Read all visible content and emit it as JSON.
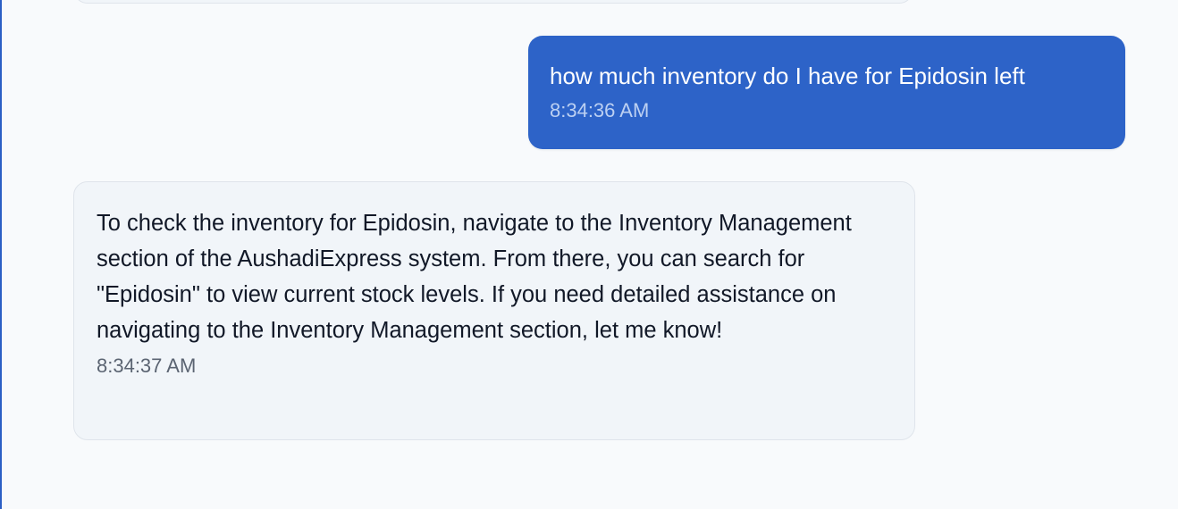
{
  "messages": [
    {
      "role": "user",
      "text": "how much inventory do I have for Epidosin left",
      "time": "8:34:36 AM"
    },
    {
      "role": "assistant",
      "text": "To check the inventory for Epidosin, navigate to the Inventory Management section of the AushadiExpress system. From there, you can search for \"Epidosin\" to view current stock levels. If you need detailed assistance on navigating to the Inventory Management section, let me know!",
      "time": "8:34:37 AM"
    }
  ],
  "colors": {
    "user_bubble": "#2d63c8",
    "assistant_bubble": "#f1f5f9",
    "background": "#f8fafc",
    "accent_border": "#2b5fc5"
  }
}
